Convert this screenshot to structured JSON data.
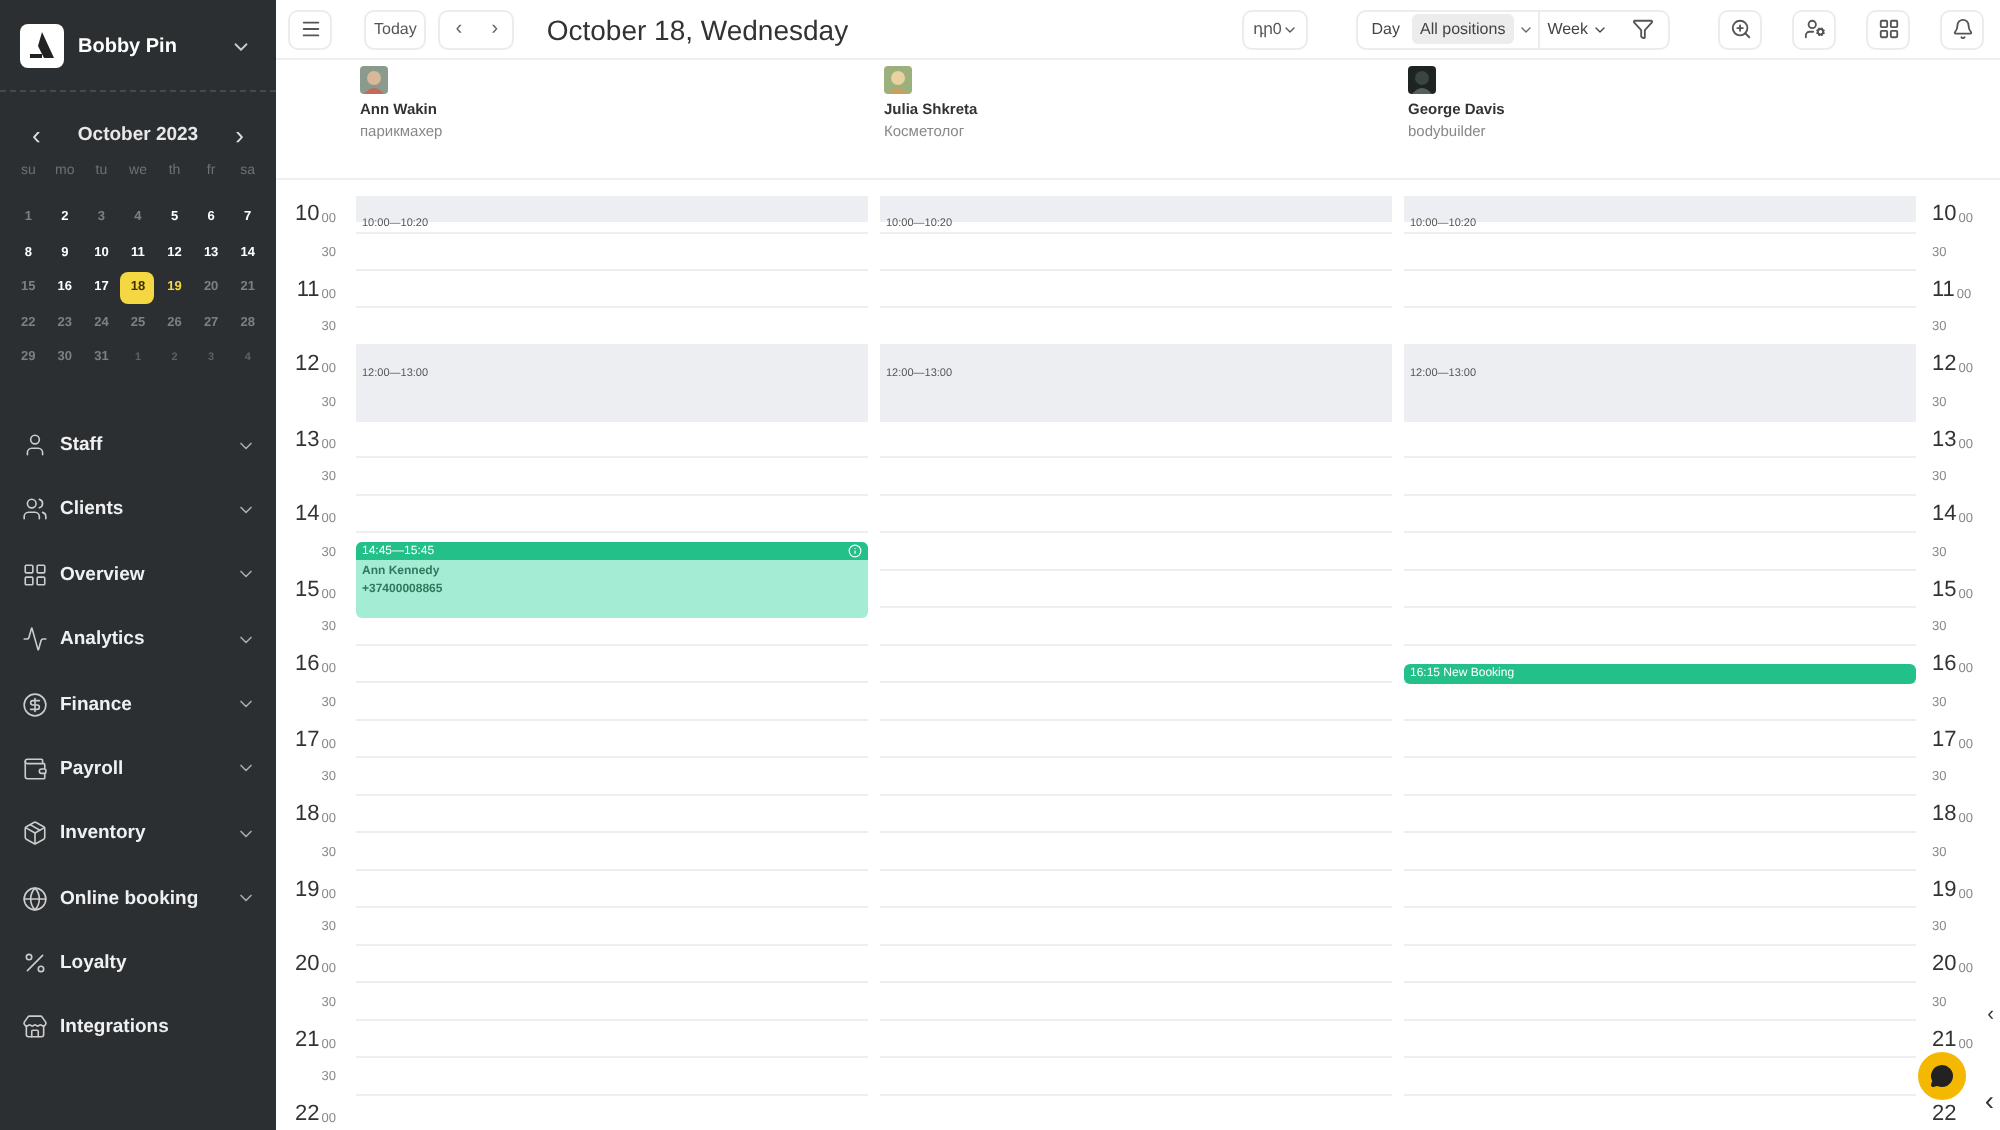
{
  "company": {
    "name": "Bobby Pin"
  },
  "mini_calendar": {
    "title": "October 2023",
    "prev": "‹",
    "next": "›",
    "weekdays": [
      "su",
      "mo",
      "tu",
      "we",
      "th",
      "fr",
      "sa"
    ],
    "days": [
      {
        "label": "1",
        "kind": "off",
        "selected": false
      },
      {
        "label": "2",
        "kind": "work",
        "selected": false
      },
      {
        "label": "3",
        "kind": "off",
        "selected": false
      },
      {
        "label": "4",
        "kind": "off",
        "selected": false
      },
      {
        "label": "5",
        "kind": "work",
        "selected": false
      },
      {
        "label": "6",
        "kind": "work",
        "selected": false
      },
      {
        "label": "7",
        "kind": "work",
        "selected": false
      },
      {
        "label": "8",
        "kind": "work",
        "selected": false
      },
      {
        "label": "9",
        "kind": "work",
        "selected": false
      },
      {
        "label": "10",
        "kind": "work",
        "selected": false
      },
      {
        "label": "11",
        "kind": "work",
        "selected": false
      },
      {
        "label": "12",
        "kind": "work",
        "selected": false
      },
      {
        "label": "13",
        "kind": "work",
        "selected": false
      },
      {
        "label": "14",
        "kind": "work",
        "selected": false
      },
      {
        "label": "15",
        "kind": "off",
        "selected": false
      },
      {
        "label": "16",
        "kind": "work",
        "selected": false
      },
      {
        "label": "17",
        "kind": "work",
        "selected": false
      },
      {
        "label": "18",
        "kind": "work",
        "selected": true
      },
      {
        "label": "19",
        "kind": "marked",
        "selected": false
      },
      {
        "label": "20",
        "kind": "off",
        "selected": false
      },
      {
        "label": "21",
        "kind": "off",
        "selected": false
      },
      {
        "label": "22",
        "kind": "off",
        "selected": false
      },
      {
        "label": "23",
        "kind": "off",
        "selected": false
      },
      {
        "label": "24",
        "kind": "off",
        "selected": false
      },
      {
        "label": "25",
        "kind": "off",
        "selected": false
      },
      {
        "label": "26",
        "kind": "off",
        "selected": false
      },
      {
        "label": "27",
        "kind": "off",
        "selected": false
      },
      {
        "label": "28",
        "kind": "off",
        "selected": false
      },
      {
        "label": "29",
        "kind": "off",
        "selected": false
      },
      {
        "label": "30",
        "kind": "off",
        "selected": false
      },
      {
        "label": "31",
        "kind": "off",
        "selected": false
      },
      {
        "label": "1",
        "kind": "outside",
        "selected": false
      },
      {
        "label": "2",
        "kind": "outside",
        "selected": false
      },
      {
        "label": "3",
        "kind": "outside",
        "selected": false
      },
      {
        "label": "4",
        "kind": "outside",
        "selected": false
      }
    ]
  },
  "sidebar": {
    "items": [
      {
        "label": "Staff",
        "expandable": true
      },
      {
        "label": "Clients",
        "expandable": true
      },
      {
        "label": "Overview",
        "expandable": true
      },
      {
        "label": "Analytics",
        "expandable": true
      },
      {
        "label": "Finance",
        "expandable": true
      },
      {
        "label": "Payroll",
        "expandable": true
      },
      {
        "label": "Inventory",
        "expandable": true
      },
      {
        "label": "Online booking",
        "expandable": true
      },
      {
        "label": "Loyalty",
        "expandable": false
      },
      {
        "label": "Integrations",
        "expandable": false
      }
    ]
  },
  "toolbar": {
    "today": "Today",
    "prev": "‹",
    "next": "›",
    "title": "October 18, Wednesday",
    "currency": "դր0",
    "views": [
      {
        "label": "Day",
        "selected": false
      },
      {
        "label": "All positions",
        "selected": true
      }
    ],
    "range": "Week"
  },
  "staff": [
    {
      "name": "Ann Wakin",
      "role": "парикмахер",
      "events": [
        {
          "kind": "blocked",
          "time": "10:00—10:20"
        },
        {
          "kind": "blocked",
          "time": "12:00—13:00"
        },
        {
          "kind": "booking",
          "time": "14:45—15:45",
          "client": "Ann Kennedy",
          "phone": "+37400008865"
        }
      ]
    },
    {
      "name": "Julia Shkreta",
      "role": "Косметолог",
      "events": [
        {
          "kind": "blocked",
          "time": "10:00—10:20"
        },
        {
          "kind": "blocked",
          "time": "12:00—13:00"
        }
      ]
    },
    {
      "name": "George Davis",
      "role": "bodybuilder",
      "events": [
        {
          "kind": "blocked",
          "time": "10:00—10:20"
        },
        {
          "kind": "blocked",
          "time": "12:00—13:00"
        },
        {
          "kind": "new",
          "time": "16:15 New Booking"
        }
      ]
    }
  ],
  "time_scale_left": [
    {
      "hour": "10",
      "minutes": "00",
      "half": "30"
    },
    {
      "hour": "11",
      "minutes": "00",
      "half": "30"
    },
    {
      "hour": "12",
      "minutes": "00",
      "half": "30"
    },
    {
      "hour": "13",
      "minutes": "00",
      "half": "30"
    },
    {
      "hour": "14",
      "minutes": "00",
      "half": "30"
    },
    {
      "hour": "15",
      "minutes": "00",
      "half": "30"
    },
    {
      "hour": "16",
      "minutes": "00",
      "half": "30"
    },
    {
      "hour": "17",
      "minutes": "00",
      "half": "30"
    },
    {
      "hour": "18",
      "minutes": "00",
      "half": "30"
    },
    {
      "hour": "19",
      "minutes": "00",
      "half": "30"
    },
    {
      "hour": "20",
      "minutes": "00",
      "half": "30"
    },
    {
      "hour": "21",
      "minutes": "00",
      "half": "30"
    },
    {
      "hour": "22",
      "minutes": "00"
    }
  ],
  "time_scale_right": [
    {
      "hour": "10",
      "minutes": "00",
      "half": "30"
    },
    {
      "hour": "11",
      "minutes": "00",
      "half": "30"
    },
    {
      "hour": "12",
      "minutes": "00",
      "half": "30"
    },
    {
      "hour": "13",
      "minutes": "00",
      "half": "30"
    },
    {
      "hour": "14",
      "minutes": "00",
      "half": "30"
    },
    {
      "hour": "15",
      "minutes": "00",
      "half": "30"
    },
    {
      "hour": "16",
      "minutes": "00",
      "half": "30"
    },
    {
      "hour": "17",
      "minutes": "00",
      "half": "30"
    },
    {
      "hour": "18",
      "minutes": "00",
      "half": "30"
    },
    {
      "hour": "19",
      "minutes": "00",
      "half": "30"
    },
    {
      "hour": "20",
      "minutes": "00",
      "half": "30"
    },
    {
      "hour": "21",
      "minutes": "00"
    },
    {
      "hour": "22"
    }
  ],
  "collapse_arrows": [
    "‹",
    "‹"
  ]
}
